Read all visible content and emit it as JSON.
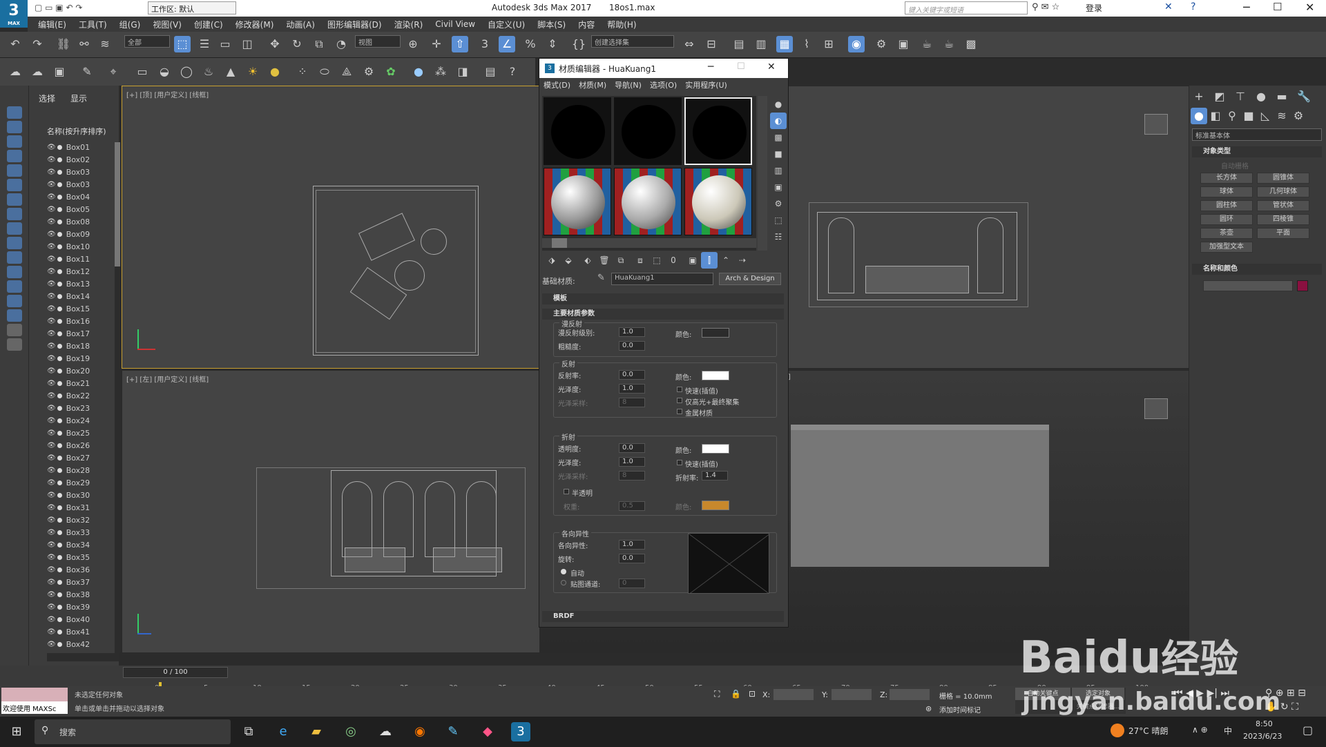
{
  "app": {
    "title": "Autodesk 3ds Max 2017",
    "file": "18os1.max",
    "workspace": "工作区: 默认",
    "search_placeholder": "键入关键字或短语",
    "login": "登录",
    "logo": "3",
    "logo_sub": "MAX"
  },
  "menu": [
    "编辑(E)",
    "工具(T)",
    "组(G)",
    "视图(V)",
    "创建(C)",
    "修改器(M)",
    "动画(A)",
    "图形编辑器(D)",
    "渲染(R)",
    "Civil View",
    "自定义(U)",
    "脚本(S)",
    "内容",
    "帮助(H)"
  ],
  "toolbar": {
    "filter": "全部",
    "view": "视图",
    "selection_set": "创建选择集"
  },
  "scene_explorer": {
    "tabs": [
      "选择",
      "显示"
    ],
    "header": "名称(按升序排序)",
    "items": [
      "Box01",
      "Box02",
      "Box03",
      "Box03",
      "Box04",
      "Box05",
      "Box08",
      "Box09",
      "Box10",
      "Box11",
      "Box12",
      "Box13",
      "Box14",
      "Box15",
      "Box16",
      "Box17",
      "Box18",
      "Box19",
      "Box20",
      "Box21",
      "Box22",
      "Box23",
      "Box24",
      "Box25",
      "Box26",
      "Box27",
      "Box28",
      "Box29",
      "Box30",
      "Box31",
      "Box32",
      "Box33",
      "Box34",
      "Box35",
      "Box36",
      "Box37",
      "Box38",
      "Box39",
      "Box40",
      "Box41",
      "Box42"
    ]
  },
  "viewports": {
    "top": "[+] [顶] [用户定义] [线框]",
    "left": "[+] [左] [用户定义] [线框]",
    "bottom_right_suffix": "]"
  },
  "material_editor": {
    "title": "材质编辑器 - HuaKuang1",
    "menu": [
      "模式(D)",
      "材质(M)",
      "导航(N)",
      "选项(O)",
      "实用程序(U)"
    ],
    "base_material_label": "基础材质:",
    "material_name": "HuaKuang1",
    "material_type": "Arch & Design",
    "sections": {
      "templates": "模板",
      "main": "主要材质参数",
      "brdf": "BRDF"
    },
    "diffuse": {
      "title": "漫反射",
      "level_label": "漫反射级别:",
      "level": "1.0",
      "roughness_label": "粗糙度:",
      "roughness": "0.0",
      "color_label": "颜色:",
      "color": "#2c2c2c"
    },
    "reflection": {
      "title": "反射",
      "reflectivity_label": "反射率:",
      "reflectivity": "0.0",
      "gloss_label": "光泽度:",
      "gloss": "1.0",
      "samples_label": "光泽采样:",
      "samples": "8",
      "color_label": "颜色:",
      "color": "#ffffff",
      "fast": "快速(插值)",
      "highlight": "仅高光+最终聚集",
      "metal": "金属材质"
    },
    "refraction": {
      "title": "折射",
      "transparency_label": "透明度:",
      "transparency": "0.0",
      "gloss_label": "光泽度:",
      "gloss": "1.0",
      "samples_label": "光泽采样:",
      "samples": "8",
      "color_label": "颜色:",
      "color": "#ffffff",
      "fast": "快速(插值)",
      "ior_label": "折射率:",
      "ior": "1.4",
      "translucency": "半透明",
      "weight_label": "权重:",
      "weight": "0.5",
      "weight_color_label": "颜色:",
      "weight_color": "#c8882c"
    },
    "anisotropy": {
      "title": "各向异性",
      "aniso_label": "各向异性:",
      "aniso": "1.0",
      "rotation_label": "旋转:",
      "rotation": "0.0",
      "auto": "自动",
      "map_channel_label": "贴图通道:",
      "map_channel": "0"
    }
  },
  "command_panel": {
    "dropdown": "标准基本体",
    "object_type": "对象类型",
    "autogrid": "自动栅格",
    "buttons": [
      "长方体",
      "圆锥体",
      "球体",
      "几何球体",
      "圆柱体",
      "管状体",
      "圆环",
      "四棱锥",
      "茶壶",
      "平面",
      "加强型文本"
    ],
    "name_color": "名称和颜色",
    "name_color_value": "#8a1040"
  },
  "timeline": {
    "frame": "0 / 100",
    "ticks": [
      "0",
      "5",
      "10",
      "15",
      "20",
      "25",
      "30",
      "35",
      "40",
      "45",
      "50",
      "55",
      "60",
      "65",
      "70",
      "75",
      "80",
      "85",
      "90",
      "95",
      "100"
    ]
  },
  "status": {
    "welcome": "欢迎使用 MAXSc",
    "line1": "未选定任何对象",
    "line2": "单击或单击并拖动以选择对象",
    "x_label": "X:",
    "y_label": "Y:",
    "z_label": "Z:",
    "grid": "栅格 = 10.0mm",
    "add_tag": "添加时间标记",
    "auto_key": "自动关键点",
    "set_key": "选定对象",
    "key_filter": "关键点过滤器..."
  },
  "taskbar": {
    "search": "搜索",
    "weather": "27°C 晴朗",
    "ime": "中",
    "time": "8:50",
    "date": "2023/6/23"
  },
  "watermark": {
    "brand": "Baidu",
    "suffix": "经验",
    "url": "jingyan.baidu.com"
  }
}
